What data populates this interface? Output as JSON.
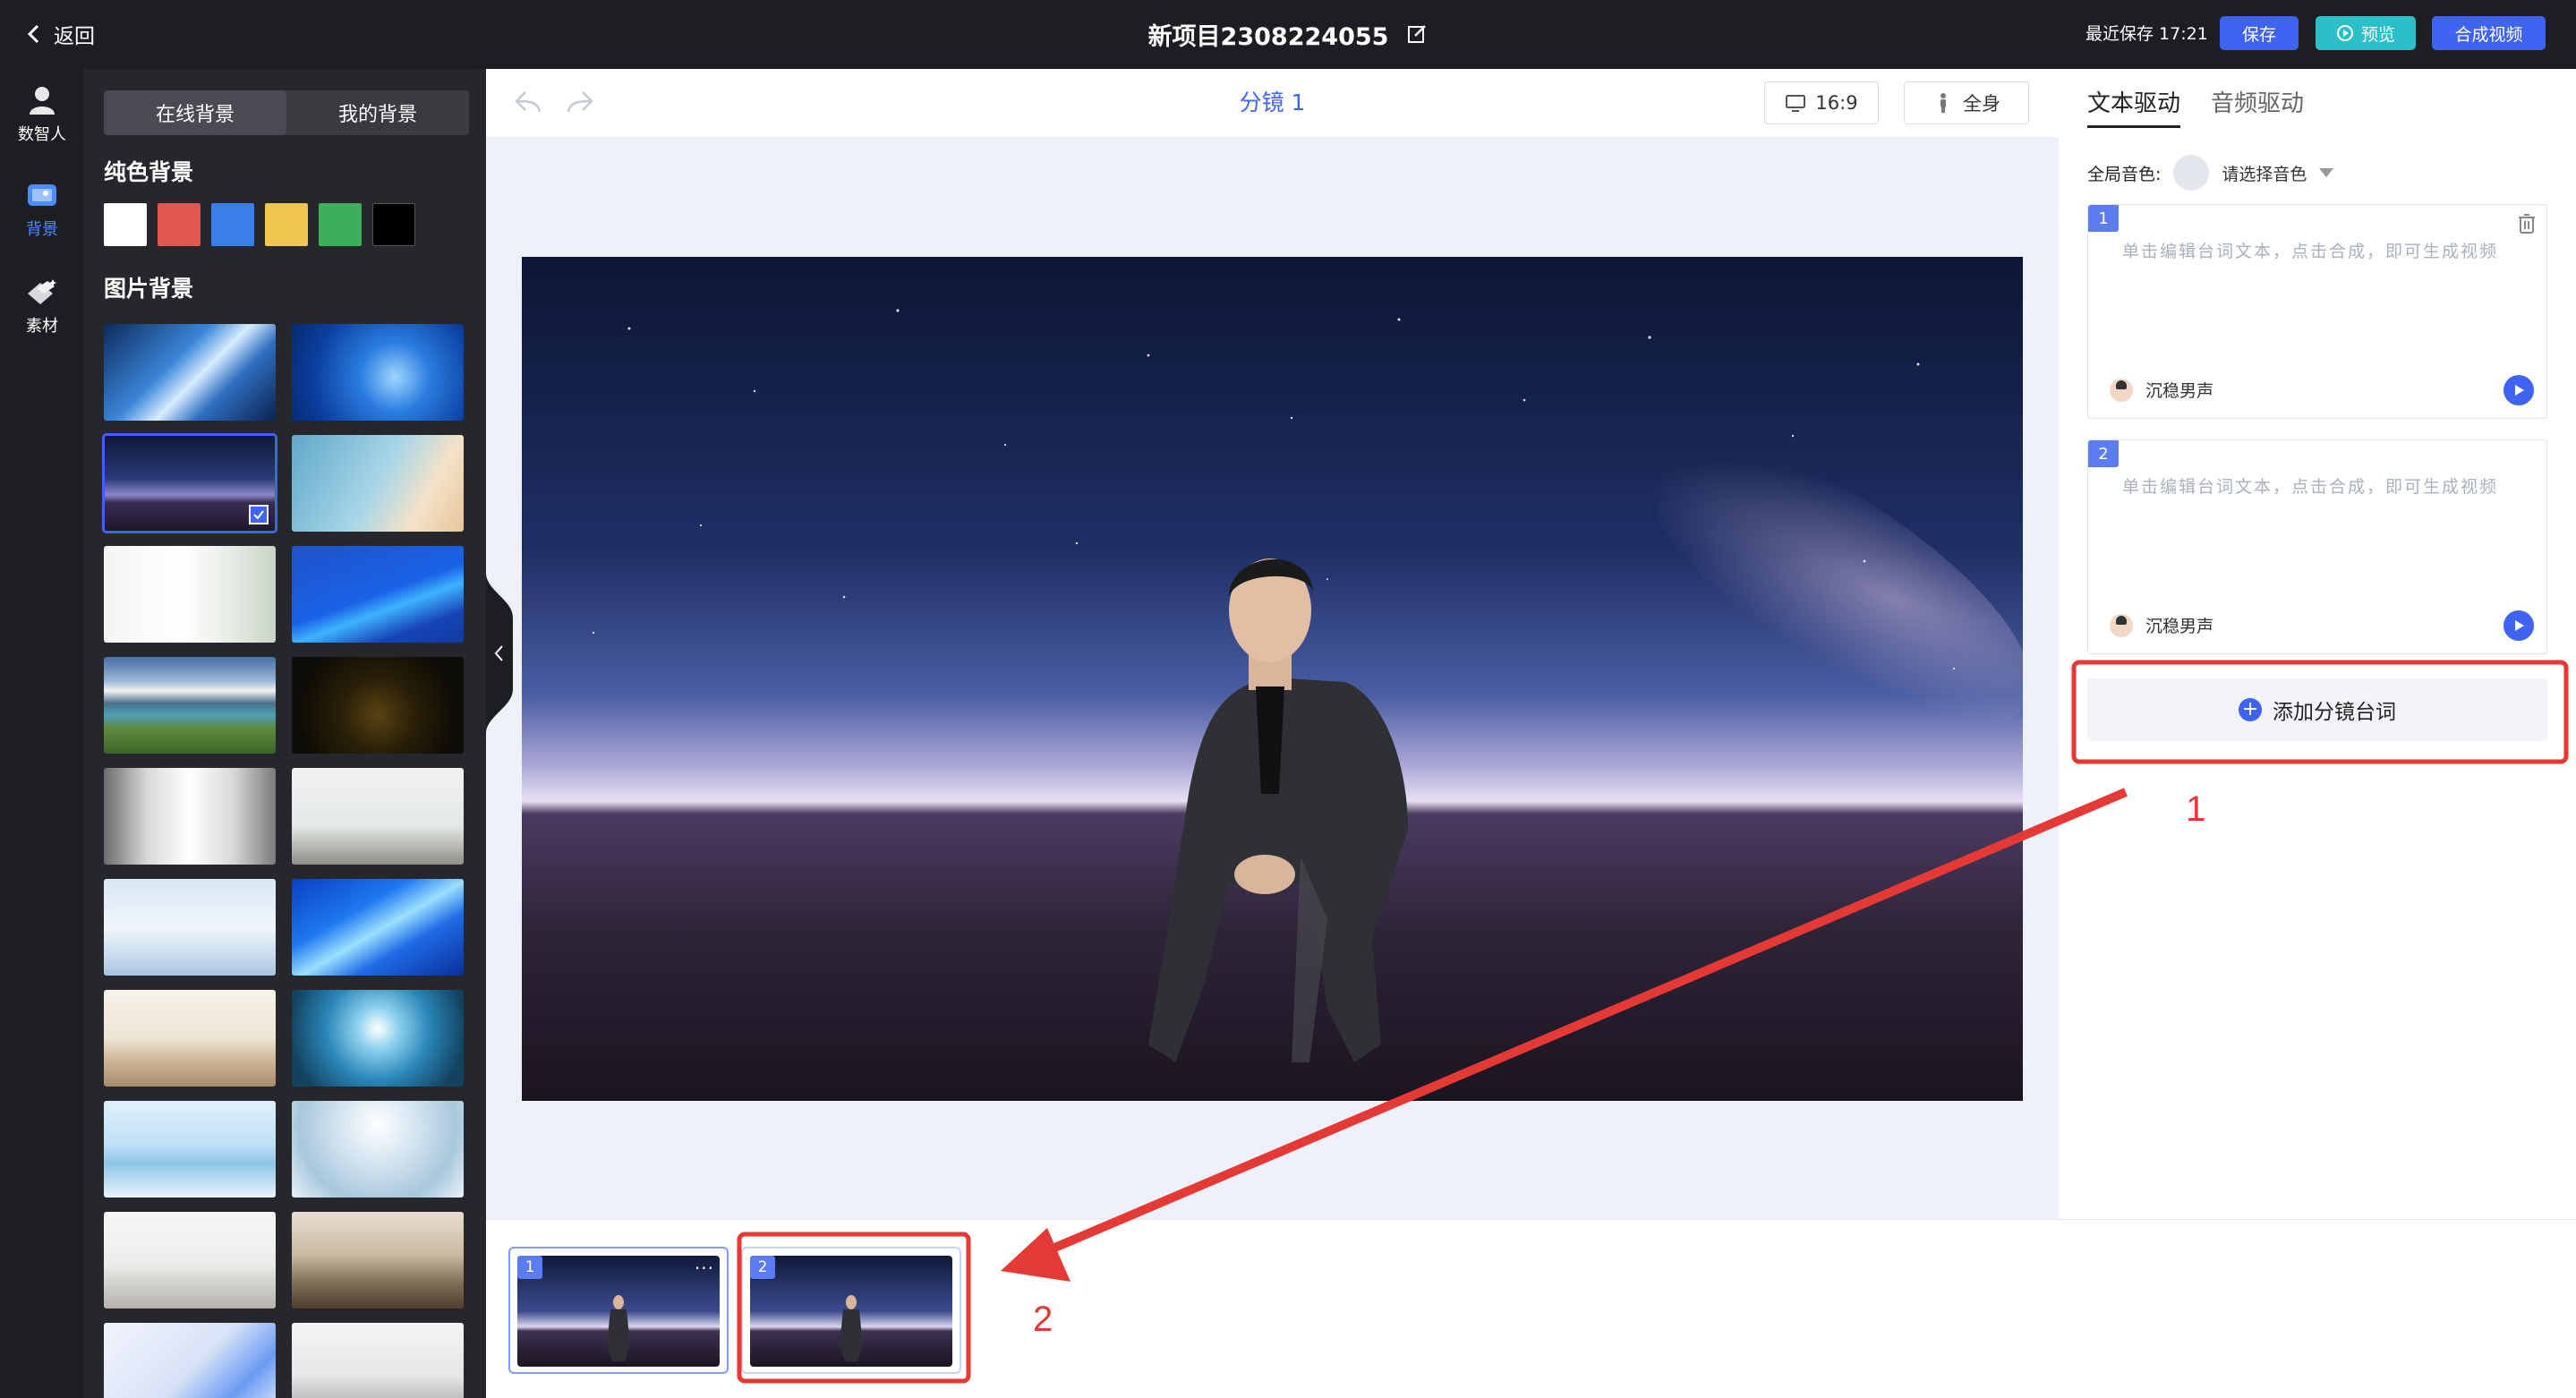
{
  "topbar": {
    "back_label": "返回",
    "project_name": "新项目2308224055",
    "last_saved": "最近保存 17:21",
    "save_label": "保存",
    "preview_label": "预览",
    "compose_label": "合成视频"
  },
  "leftnav": {
    "items": [
      {
        "label": "数智人",
        "icon": "person-icon"
      },
      {
        "label": "背景",
        "icon": "background-icon"
      },
      {
        "label": "素材",
        "icon": "material-icon"
      }
    ],
    "active": "背景"
  },
  "background_panel": {
    "tabs": [
      "在线背景",
      "我的背景"
    ],
    "active_tab": "在线背景",
    "solid_title": "纯色背景",
    "solid_colors": [
      "#ffffff",
      "#e0574f",
      "#3b7de9",
      "#eec74f",
      "#3fae5b",
      "#000000"
    ],
    "image_title": "图片背景",
    "selected_index": 2
  },
  "center": {
    "scene_title": "分镜 1",
    "aspect_ratio": "16:9",
    "body_mode": "全身"
  },
  "right_panel": {
    "tabs": [
      "文本驱动",
      "音频驱动"
    ],
    "active_tab": "文本驱动",
    "global_voice_label": "全局音色:",
    "global_voice_placeholder": "请选择音色",
    "scripts": [
      {
        "index": "1",
        "placeholder": "单击编辑台词文本，点击合成，即可生成视频",
        "voice": "沉稳男声"
      },
      {
        "index": "2",
        "placeholder": "单击编辑台词文本，点击合成，即可生成视频",
        "voice": "沉稳男声"
      }
    ],
    "add_label": "添加分镜台词"
  },
  "timeline": {
    "scenes": [
      {
        "index": "1",
        "more": "···"
      },
      {
        "index": "2"
      }
    ]
  },
  "annotations": {
    "label_1": "1",
    "label_2": "2",
    "color": "#e53935"
  }
}
